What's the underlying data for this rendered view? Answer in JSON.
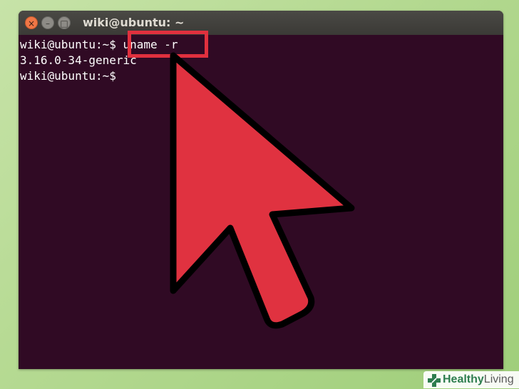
{
  "window": {
    "title": "wiki@ubuntu: ~",
    "buttons": {
      "close": "×",
      "minimize": "–",
      "maximize": "□"
    }
  },
  "terminal": {
    "line1_prompt": "wiki@ubuntu:~$",
    "line1_command": " uname -r",
    "line2_output": "3.16.0-34-generic",
    "line3_prompt": "wiki@ubuntu:~$"
  },
  "overlay": {
    "highlight_color": "#e0303e",
    "arrow": "mouse-pointer-arrow-icon",
    "arrow_color": "#e03240"
  },
  "watermark": {
    "part1": "Healthy",
    "part2": "Living"
  },
  "colors": {
    "terminal_bg": "#300a24",
    "titlebar": "#3c3b37",
    "close_button": "#f07746",
    "logo_green": "#2e7d4f"
  }
}
